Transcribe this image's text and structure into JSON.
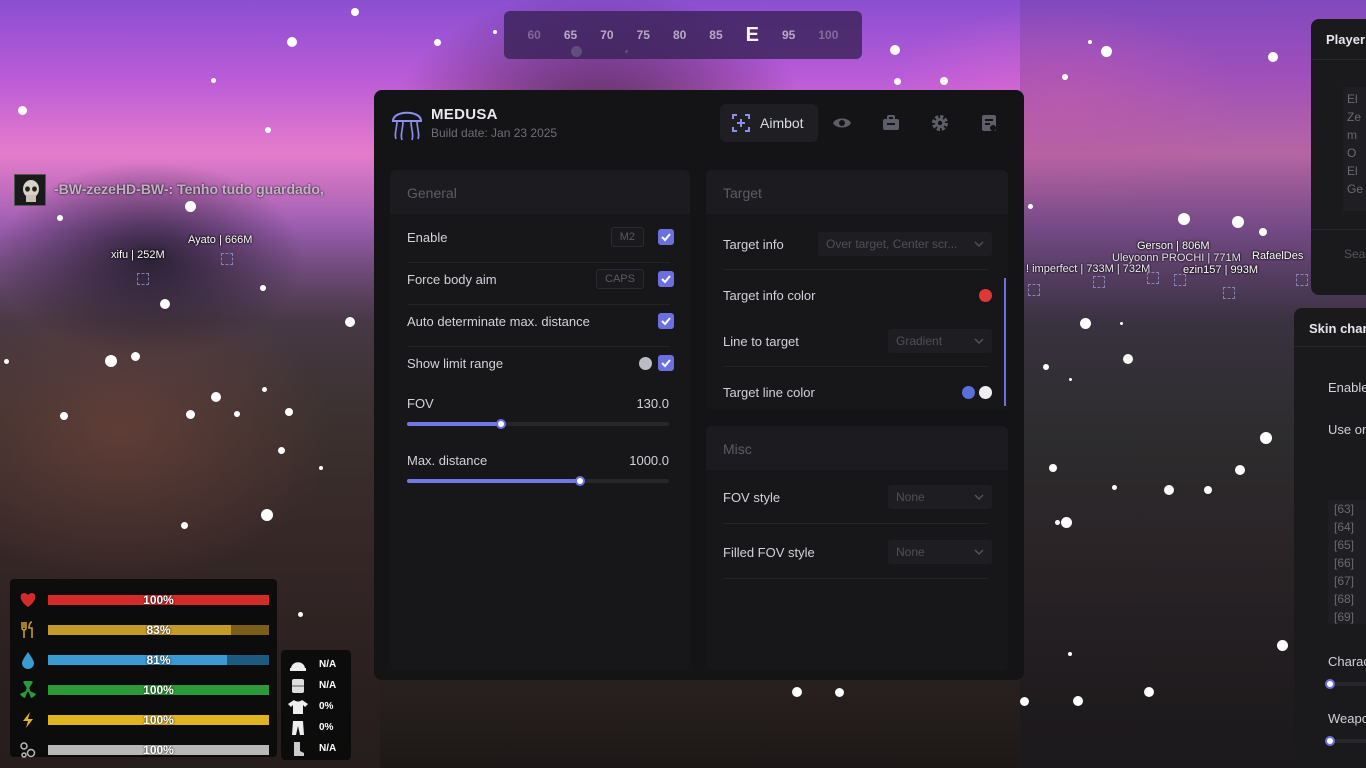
{
  "compass": {
    "ticks": [
      "60",
      "65",
      "70",
      "75",
      "80",
      "85",
      "E",
      "95",
      "100"
    ]
  },
  "chat": {
    "message": "-BW-zezeHD-BW-: Tenho tudo guardado,"
  },
  "world_tags": [
    "xifu | 252M",
    "Ayato | 666M",
    "Gerson | 806M",
    "! imperfect | 733M | 732M",
    "Uleyoonn PROCHI | 771M",
    "ezin157 | 993M",
    "RafaelDes"
  ],
  "stats": [
    {
      "icon": "heart-icon",
      "label": "100%",
      "value": 1.0,
      "color": "#d42a2a",
      "bg": "#7a1414"
    },
    {
      "icon": "food-icon",
      "label": "83%",
      "value": 0.83,
      "color": "#c49a28",
      "bg": "#7a5e1a"
    },
    {
      "icon": "water-icon",
      "label": "81%",
      "value": 0.81,
      "color": "#3a9ad2",
      "bg": "#1d5a80"
    },
    {
      "icon": "radiation-icon",
      "label": "100%",
      "value": 1.0,
      "color": "#2c9a38",
      "bg": "#175a20"
    },
    {
      "icon": "energy-icon",
      "label": "100%",
      "value": 1.0,
      "color": "#e0b420",
      "bg": "#7a6214"
    },
    {
      "icon": "oxygen-icon",
      "label": "100%",
      "value": 1.0,
      "color": "#b8b8b8",
      "bg": "#555555"
    }
  ],
  "gear": [
    {
      "icon": "helmet-icon",
      "value": "N/A"
    },
    {
      "icon": "vest-icon",
      "value": "N/A"
    },
    {
      "icon": "shirt-icon",
      "value": "0%"
    },
    {
      "icon": "pants-icon",
      "value": "0%"
    },
    {
      "icon": "boots-icon",
      "value": "N/A"
    }
  ],
  "menu": {
    "brand": "MEDUSA",
    "build_date": "Build date: Jan 23 2025",
    "active_tab": "Aimbot",
    "accent": "#6b6fe0",
    "general": {
      "title": "General",
      "enable": {
        "label": "Enable",
        "key": "M2",
        "checked": true
      },
      "force_body_aim": {
        "label": "Force body aim",
        "key": "CAPS",
        "checked": true
      },
      "auto_distance": {
        "label": "Auto determinate max. distance",
        "checked": true
      },
      "show_limit_range": {
        "label": "Show limit range",
        "checked": true
      },
      "fov": {
        "label": "FOV",
        "value": "130.0",
        "fraction": 0.36
      },
      "max_distance": {
        "label": "Max. distance",
        "value": "1000.0",
        "fraction": 0.66
      }
    },
    "target": {
      "title": "Target",
      "target_info": {
        "label": "Target info",
        "value": "Over target, Center scr..."
      },
      "target_info_color": {
        "label": "Target info color",
        "color": "#e03838"
      },
      "line_to_target": {
        "label": "Line to target",
        "value": "Gradient"
      },
      "target_line_color": {
        "label": "Target line color",
        "color1": "#5a70d8",
        "color2": "#eeeeee"
      }
    },
    "misc": {
      "title": "Misc",
      "fov_style": {
        "label": "FOV style",
        "value": "None"
      },
      "filled_fov_style": {
        "label": "Filled FOV style",
        "value": "None"
      }
    }
  },
  "player_panel": {
    "title": "Player",
    "list": [
      "El",
      "Ze",
      "m",
      "O",
      "El",
      "Ge"
    ],
    "search": "Sea"
  },
  "skin_panel": {
    "title": "Skin char",
    "enable": "Enable",
    "use_on": "Use on",
    "list": [
      "[63]",
      "[64]",
      "[65]",
      "[66]",
      "[67]",
      "[68]",
      "[69]"
    ],
    "character_label": "Charac",
    "weapon_label": "Weapo"
  }
}
